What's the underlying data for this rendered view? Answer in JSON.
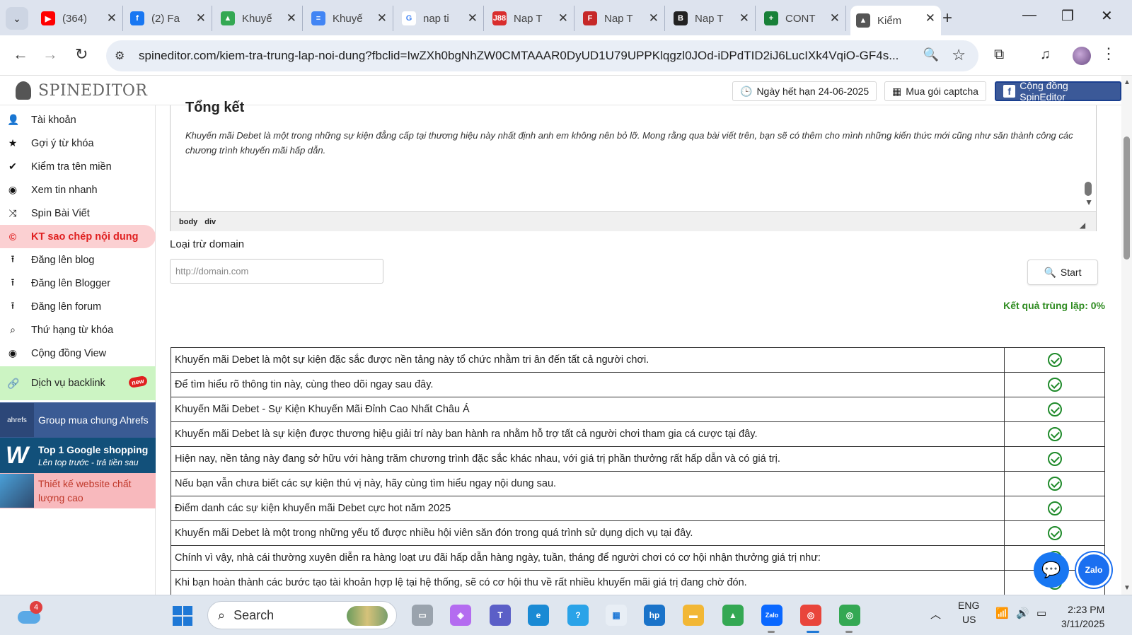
{
  "browser": {
    "tabs": [
      {
        "label": "(364)",
        "favicon": "youtube-icon",
        "color": "#ff0000",
        "glyph": "▶"
      },
      {
        "label": "(2) Fa",
        "favicon": "facebook-icon",
        "color": "#1877f2",
        "glyph": "f"
      },
      {
        "label": "Khuyế",
        "favicon": "google-drive-icon",
        "color": "#34a853",
        "glyph": "▲"
      },
      {
        "label": "Khuyế",
        "favicon": "google-docs-icon",
        "color": "#4285f4",
        "glyph": "≡"
      },
      {
        "label": "nap ti",
        "favicon": "google-icon",
        "color": "#ffffff",
        "glyph": "G"
      },
      {
        "label": "Nap T",
        "favicon": "j88-icon",
        "color": "#d92d2d",
        "glyph": "J88"
      },
      {
        "label": "Nap T",
        "favicon": "site-icon",
        "color": "#c62828",
        "glyph": "F"
      },
      {
        "label": "Nap T",
        "favicon": "site-icon",
        "color": "#222222",
        "glyph": "B"
      },
      {
        "label": "CONT",
        "favicon": "google-sheets-icon",
        "color": "#188038",
        "glyph": "+"
      },
      {
        "label": "Kiểm",
        "favicon": "spineditor-icon",
        "color": "#555555",
        "glyph": "▲"
      }
    ],
    "url": "spineditor.com/kiem-tra-trung-lap-noi-dung?fbclid=IwZXh0bgNhZW0CMTAAAR0DyUD1U79UPPKlqgzl0JOd-iDPdTID2iJ6LucIXk4VqiO-GF4s..."
  },
  "site": {
    "logo_text": "SPINEDITOR",
    "expiry_label": "Ngày hết hạn 24-06-2025",
    "captcha_label": "Mua gói captcha",
    "community_label": "Cộng đồng SpinEditor"
  },
  "sidebar": {
    "items": [
      {
        "label": "Tài khoản",
        "icon": "user-icon",
        "glyph": "👤"
      },
      {
        "label": "Gợi ý từ khóa",
        "icon": "star-icon",
        "glyph": "★"
      },
      {
        "label": "Kiểm tra tên miền",
        "icon": "check-icon",
        "glyph": "✔"
      },
      {
        "label": "Xem tin nhanh",
        "icon": "eye-icon",
        "glyph": "◉"
      },
      {
        "label": "Spin Bài Viết",
        "icon": "shuffle-icon",
        "glyph": "⤨"
      },
      {
        "label": "KT sao chép nội dung",
        "icon": "copyright-icon",
        "glyph": "©"
      },
      {
        "label": "Đăng lên blog",
        "icon": "upload-icon",
        "glyph": "⭱"
      },
      {
        "label": "Đăng lên Blogger",
        "icon": "upload-icon",
        "glyph": "⭱"
      },
      {
        "label": "Đăng lên forum",
        "icon": "upload-icon",
        "glyph": "⭱"
      },
      {
        "label": "Thứ hạng từ khóa",
        "icon": "search-icon",
        "glyph": "⌕"
      },
      {
        "label": "Cộng đồng View",
        "icon": "eye-icon",
        "glyph": "◉"
      }
    ],
    "backlink_label": "Dịch vụ backlink",
    "new_badge": "new",
    "promos": [
      {
        "title": "Group mua chung Ahrefs",
        "subtitle": "",
        "bg": "#3a5b94",
        "color": "#ffffff",
        "icon_text": "ahrefs"
      },
      {
        "title": "Top 1 Google shopping",
        "subtitle": "Lên top trước - trả tiền sau",
        "bg": "#12507a",
        "color": "#ffffff",
        "icon_text": "W"
      },
      {
        "title": "Thiết kế website chất lượng cao",
        "subtitle": "",
        "bg": "#f8b9bd",
        "color": "#c0392b",
        "icon_text": ""
      }
    ]
  },
  "editor": {
    "heading": "Tổng kết",
    "body": "Khuyến mãi Debet là một trong những sự kiện đẳng cấp tại thương hiệu này nhất định anh em không nên bỏ lỡ. Mong rằng qua bài viết trên, bạn sẽ có thêm cho mình những kiến thức mới cũng như săn thành công các chương trình khuyến mãi hấp dẫn.",
    "path": [
      "body",
      "div"
    ]
  },
  "exclude": {
    "label": "Loại trừ domain",
    "placeholder": "http://domain.com",
    "start_label": "Start"
  },
  "result_label": "Kết quả trùng lặp: 0%",
  "results": [
    "Khuyến mãi Debet là một sự kiện đặc sắc được nền tảng này tổ chức nhằm tri ân đến tất cả người chơi.",
    "Để tìm hiểu rõ thông tin này, cùng theo dõi ngay sau đây.",
    "Khuyến Mãi Debet - Sự Kiện Khuyến Mãi Đỉnh Cao Nhất Châu Á",
    "Khuyến mãi Debet là sự kiện được thương hiệu giải trí này ban hành ra nhằm hỗ trợ tất cả người chơi tham gia cá cược tại đây.",
    "Hiện nay, nền tảng này đang sở hữu với hàng trăm chương trình đặc sắc khác nhau, với giá trị phần thưởng rất hấp dẫn và có giá trị.",
    "Nếu bạn vẫn chưa biết các sự kiện thú vị này, hãy cùng tìm hiểu ngay nội dung sau.",
    "Điểm danh các sự kiện khuyến mãi Debet cực hot năm 2025",
    "Khuyến mãi Debet là một trong những yếu tố được nhiều hội viên săn đón trong quá trình sử dụng dịch vụ tại đây.",
    "Chính vì vậy, nhà cái thường xuyên diễn ra hàng loạt ưu đãi hấp dẫn hàng ngày, tuần, tháng để người chơi có cơ hội nhận thưởng giá trị như:",
    "Khi bạn hoàn thành các bước tạo tài khoản hợp lệ tại hệ thống, sẽ có cơ hội thu về rất nhiều khuyến mãi giá trị đang chờ đón."
  ],
  "floating": {
    "zalo_label": "Zalo"
  },
  "taskbar": {
    "weather_badge": "4",
    "search_label": "Search",
    "apps": [
      {
        "name": "file-manager-icon",
        "color": "#9aa3ad",
        "glyph": "▭"
      },
      {
        "name": "copilot-icon",
        "color": "#b46cf0",
        "glyph": "◈"
      },
      {
        "name": "teams-icon",
        "color": "#5b5fc7",
        "glyph": "T"
      },
      {
        "name": "edge-icon",
        "color": "#1a8ad4",
        "glyph": "e"
      },
      {
        "name": "help-icon",
        "color": "#2aa3e8",
        "glyph": "?"
      },
      {
        "name": "store-icon",
        "color": "#e8eef5",
        "glyph": "▦"
      },
      {
        "name": "myhp-icon",
        "color": "#1a73c9",
        "glyph": "hp"
      },
      {
        "name": "folder-icon",
        "color": "#f2b735",
        "glyph": "▬"
      },
      {
        "name": "google-drive-icon",
        "color": "#34a853",
        "glyph": "▲"
      },
      {
        "name": "zalo-icon",
        "color": "#0a68ff",
        "glyph": "Zalo"
      },
      {
        "name": "chrome-icon",
        "color": "#e9453b",
        "glyph": "◎"
      },
      {
        "name": "chrome-profile-icon",
        "color": "#34a853",
        "glyph": "◎"
      }
    ],
    "lang_top": "ENG",
    "lang_bottom": "US",
    "time": "2:23 PM",
    "date": "3/11/2025"
  }
}
